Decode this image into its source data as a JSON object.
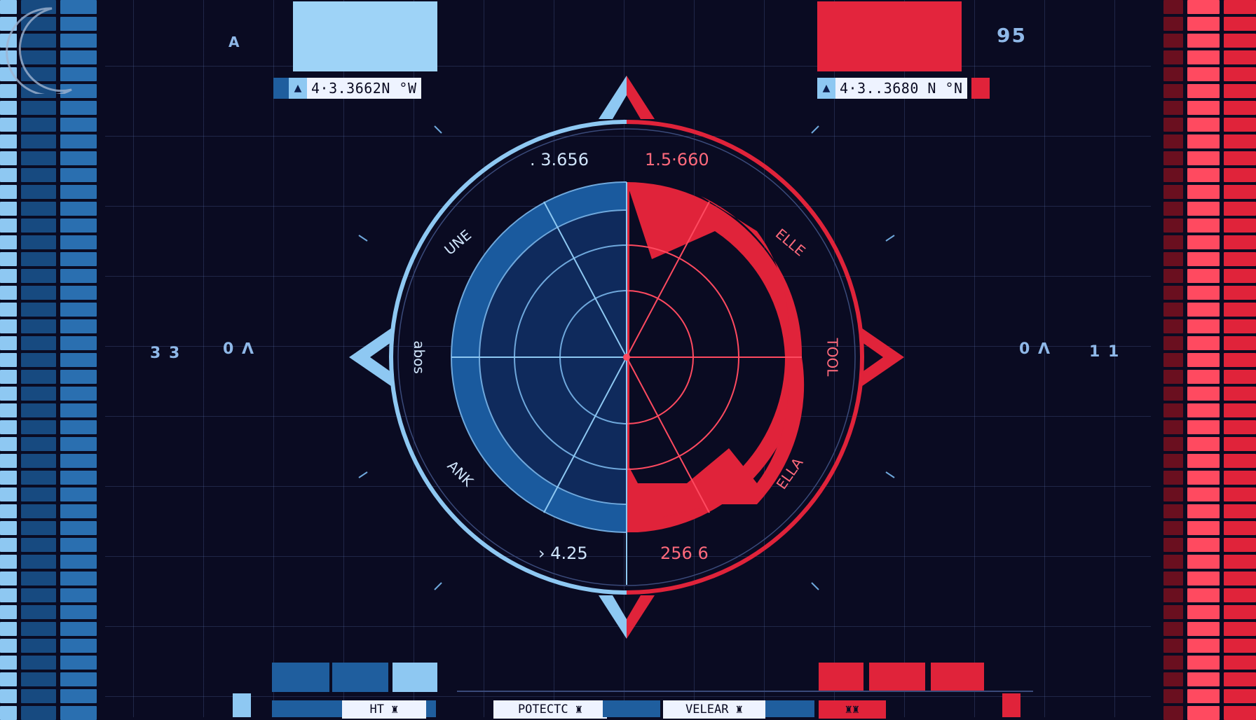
{
  "coords": {
    "left": "4·3.3662N °W",
    "right": "4·3..3680 N °N",
    "left_marker": "▲",
    "right_marker": "▲"
  },
  "corner_labels": {
    "top_left": "A",
    "top_right": "95"
  },
  "side_labels": {
    "left_outer": "3 3",
    "left_inner": "0 ᐱ",
    "right_inner": "0 ᐱ",
    "right_outer": "1 1"
  },
  "radar": {
    "top_left_value": ". 3.656",
    "top_right_value": "1.5·660",
    "bottom_left_value": "› 4.25",
    "bottom_right_value": "256 6",
    "upper_left_label": "UNE",
    "upper_right_label": "ELLE",
    "mid_left_label": "abos",
    "mid_right_label": "TOOL",
    "lower_left_label": "ANK",
    "lower_right_label": "ELLA"
  },
  "bottom_tags": [
    "HT ♜",
    "POTECTC ♜",
    "VELEAR ♜",
    "♜♜"
  ],
  "colors": {
    "background": "#0a0b22",
    "blue": "#1f5e9e",
    "light_blue": "#8ec8f2",
    "red": "#e0233a",
    "dark_red": "#6a0f1f"
  }
}
